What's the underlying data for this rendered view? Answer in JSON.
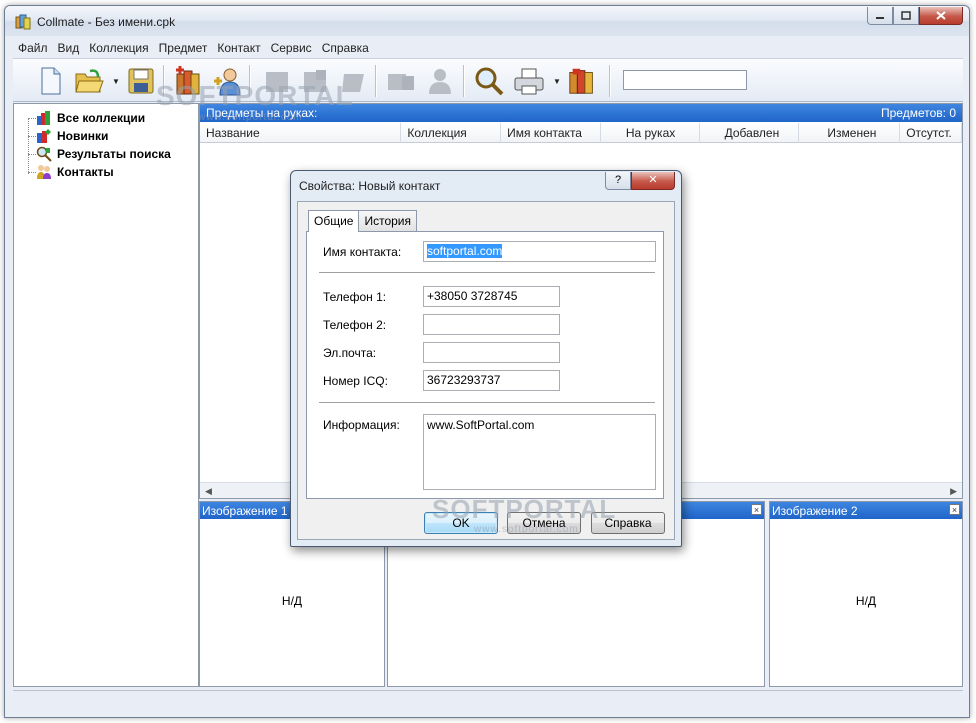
{
  "window": {
    "title": "Collmate - Без имени.cpk"
  },
  "menu": [
    "Файл",
    "Вид",
    "Коллекция",
    "Предмет",
    "Контакт",
    "Сервис",
    "Справка"
  ],
  "toolbar": {
    "search_value": ""
  },
  "tree": {
    "items": [
      {
        "label": "Все коллекции",
        "icon": "all-collections-icon"
      },
      {
        "label": "Новинки",
        "icon": "new-items-icon"
      },
      {
        "label": "Результаты поиска",
        "icon": "search-results-icon"
      },
      {
        "label": "Контакты",
        "icon": "contacts-icon"
      }
    ]
  },
  "grid": {
    "header_left": "Предметы на руках:",
    "header_right": "Предметов: 0",
    "columns": [
      "Название",
      "Коллекция",
      "Имя контакта",
      "На руках",
      "Добавлен",
      "Изменен",
      "Отсутст."
    ]
  },
  "images": {
    "panel1_title": "Изображение 1",
    "panel2_title": "Изображение 2",
    "nd1": "Н/Д",
    "nd2": "Н/Д"
  },
  "watermark": {
    "logo": "SOFTPORTAL",
    "url": "www.softportal.com"
  },
  "dialog": {
    "title": "Свойства: Новый контакт",
    "tabs": [
      "Общие",
      "История"
    ],
    "fields": {
      "name_label": "Имя контакта:",
      "name_value": "softportal.com",
      "phone1_label": "Телефон 1:",
      "phone1_value": "+38050 3728745",
      "phone2_label": "Телефон 2:",
      "phone2_value": "",
      "email_label": "Эл.почта:",
      "email_value": "",
      "icq_label": "Номер ICQ:",
      "icq_value": "36723293737",
      "info_label": "Информация:",
      "info_value": "www.SoftPortal.com"
    },
    "buttons": {
      "ok": "OK",
      "cancel": "Отмена",
      "help": "Справка"
    }
  },
  "colors": {
    "header_blue": "#1f64c8",
    "window_bg": "#e9eef6"
  }
}
